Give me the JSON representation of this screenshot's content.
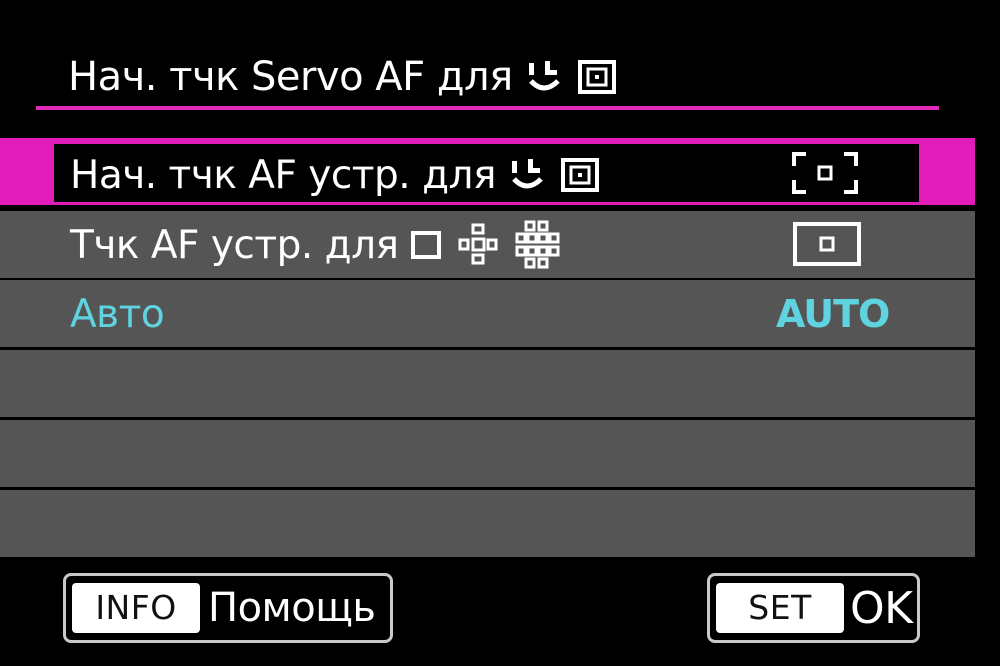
{
  "header": {
    "title": "Нач. тчк Servo AF для",
    "title_icons": [
      "face-tracking-icon",
      "af-frame-icon"
    ]
  },
  "menu": {
    "items": [
      {
        "label": "Нач. тчк AF устр. для",
        "label_icons": [
          "face-tracking-icon",
          "af-frame-icon"
        ],
        "value_icon": "af-area-bracket-icon",
        "selected": true
      },
      {
        "label": "Тчк AF устр. для",
        "label_icons": [
          "single-point-af-icon",
          "zone-af-icon",
          "large-zone-af-icon"
        ],
        "value_icon": "single-point-frame-icon",
        "selected": false
      },
      {
        "label": "Авто",
        "value": "AUTO",
        "selected": false
      }
    ]
  },
  "footer": {
    "info_key": "INFO",
    "info_label": "Помощь",
    "set_key": "SET",
    "set_label": "OK"
  },
  "colors": {
    "accent": "#e21cb8",
    "highlight_text": "#5fd4e0",
    "row_background": "#555555",
    "screen_background": "#000000"
  }
}
